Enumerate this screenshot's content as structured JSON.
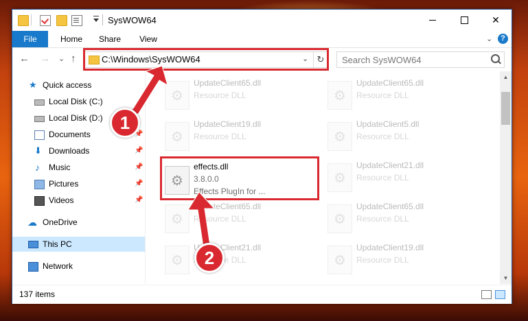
{
  "window": {
    "title": "SysWOW64",
    "controls": {
      "minimize": "—",
      "maximize": "☐",
      "close": "✕"
    }
  },
  "ribbon": {
    "tabs": [
      "File",
      "Home",
      "Share",
      "View"
    ],
    "expand_icon": "⌄",
    "help_icon": "?"
  },
  "navigation": {
    "back": "←",
    "forward": "→",
    "recent": "⌄",
    "up": "↑",
    "address": "C:\\Windows\\SysWOW64",
    "address_dropdown": "⌄",
    "refresh": "↻",
    "search_placeholder": "Search SysWOW64"
  },
  "sidebar": {
    "items": [
      {
        "label": "Quick access",
        "icon": "star-icon"
      },
      {
        "label": "Local Disk (C:)",
        "icon": "drive-icon"
      },
      {
        "label": "Local Disk (D:)",
        "icon": "drive-icon"
      },
      {
        "label": "Documents",
        "icon": "documents-icon",
        "pin": "📌"
      },
      {
        "label": "Downloads",
        "icon": "downloads-icon",
        "pin": "📌"
      },
      {
        "label": "Music",
        "icon": "music-icon",
        "pin": "📌"
      },
      {
        "label": "Pictures",
        "icon": "pictures-icon",
        "pin": "📌"
      },
      {
        "label": "Videos",
        "icon": "videos-icon",
        "pin": "📌"
      },
      {
        "label": "OneDrive",
        "icon": "cloud-icon"
      },
      {
        "label": "This PC",
        "icon": "pc-icon",
        "selected": true
      },
      {
        "label": "Network",
        "icon": "network-icon"
      }
    ]
  },
  "files": [
    {
      "name": "UpdateClient65.dll",
      "sub": "Resource DLL",
      "faded": true
    },
    {
      "name": "UpdateClient65.dll",
      "sub": "Resource DLL",
      "faded": true
    },
    {
      "name": "UpdateClient19.dll",
      "sub": "Resource DLL",
      "faded": true
    },
    {
      "name": "UpdateClient5.dll",
      "sub": "Resource DLL",
      "faded": true
    },
    {
      "name": "effects.dll",
      "sub": "3.8.0.0",
      "sub2": "Effects PlugIn for ...",
      "faded": false
    },
    {
      "name": "UpdateClient21.dll",
      "sub": "Resource DLL",
      "faded": true
    },
    {
      "name": "UpdateClient65.dll",
      "sub": "Resource DLL",
      "faded": true
    },
    {
      "name": "UpdateClient65.dll",
      "sub": "Resource DLL",
      "faded": true
    },
    {
      "name": "UpdateClient21.dll",
      "sub": "Resource DLL",
      "faded": true
    },
    {
      "name": "UpdateClient19.dll",
      "sub": "Resource DLL",
      "faded": true
    }
  ],
  "status": {
    "item_count": "137 items"
  },
  "annotations": {
    "step1": "1",
    "step2": "2",
    "highlight_color": "#d9282f"
  }
}
